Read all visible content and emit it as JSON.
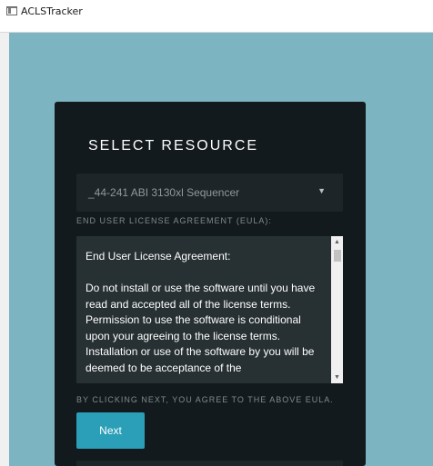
{
  "window": {
    "title": "ACLSTracker",
    "icon": "app-window-icon"
  },
  "colors": {
    "background": "#7db4c2",
    "panel": "#131a1d",
    "accent": "#2a9fb7",
    "text": "#ffffff",
    "muted_text": "#7f8a8e"
  },
  "panel": {
    "title": "SELECT RESOURCE",
    "resource_select": {
      "value": "_44-241 ABI 3130xl Sequencer",
      "caret_icon": "caret-down-icon"
    },
    "eula_label": "END USER LICENSE AGREEMENT (EULA):",
    "eula": {
      "heading": "End User License Agreement:",
      "body": "Do not install or use the software until you have read and accepted all of the license terms. Permission to use the software is conditional upon your agreeing to the license terms. Installation or use of the software by you will be deemed to be acceptance of the"
    },
    "agree_text": "BY CLICKING NEXT, YOU AGREE TO THE ABOVE EULA.",
    "next_label": "Next"
  }
}
